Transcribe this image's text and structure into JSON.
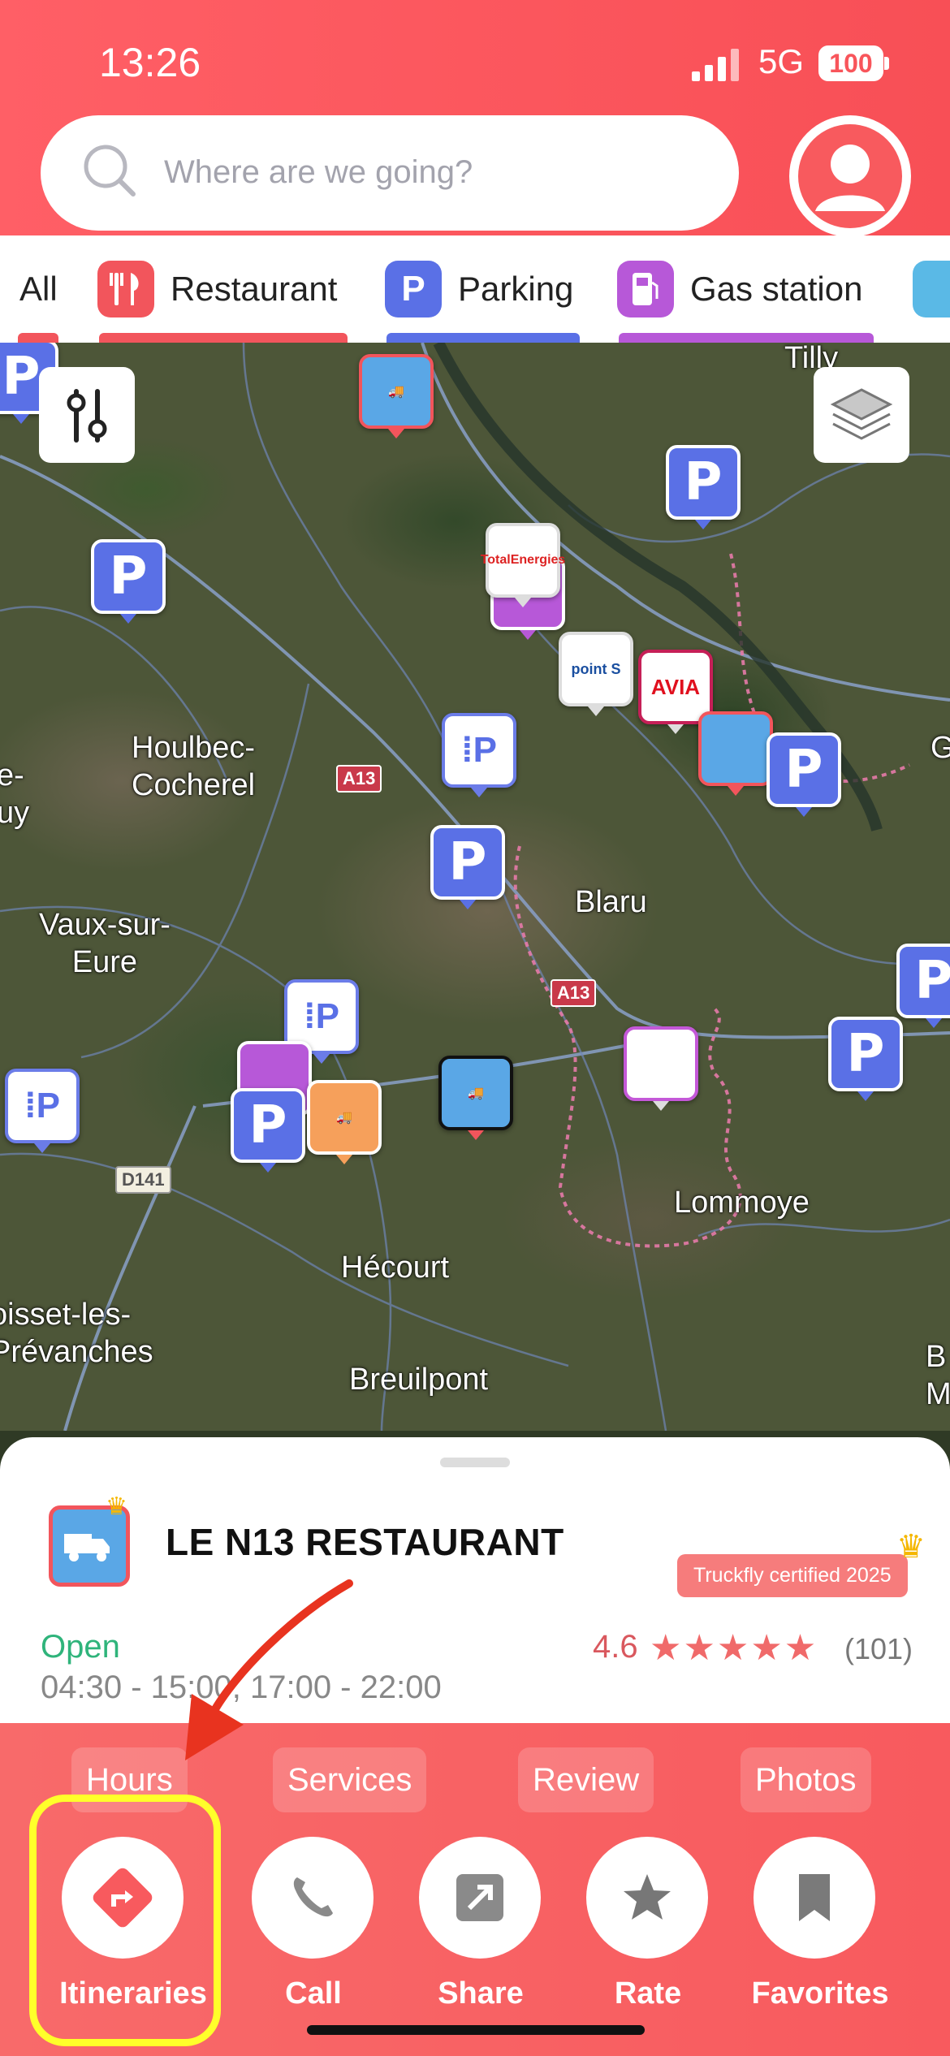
{
  "status": {
    "time": "13:26",
    "network": "5G",
    "battery": "100"
  },
  "search": {
    "placeholder": "Where are we going?"
  },
  "categories": [
    {
      "label": "All"
    },
    {
      "label": "Restaurant",
      "color": "#f2555c"
    },
    {
      "label": "Parking",
      "color": "#5a70e6"
    },
    {
      "label": "Gas station",
      "color": "#b758d8"
    }
  ],
  "map": {
    "towns": [
      "Tilly",
      "Houlbec-\nCocherel",
      "Vaux-sur-\nEure",
      "Blaru",
      "Lommoye",
      "Hécourt",
      "Breuilpont",
      "oisset-les-\nPrévanches",
      "e-\nuy",
      "G",
      "B\nMa"
    ],
    "roads": [
      "A13",
      "A13",
      "D141"
    ],
    "brand_pins": [
      "point S",
      "AVIA",
      "TotalEnergies"
    ]
  },
  "place": {
    "name": "LE N13 RESTAURANT",
    "badge": "Truckfly certified 2025",
    "status": "Open",
    "hours": "04:30 - 15:00, 17:00 - 22:00",
    "rating": "4.6",
    "stars": "★★★★★",
    "reviews": "(101)"
  },
  "tabs": [
    "Hours",
    "Services",
    "Review",
    "Photos"
  ],
  "actions": [
    {
      "label": "Itineraries",
      "icon": "directions-icon"
    },
    {
      "label": "Call",
      "icon": "phone-icon"
    },
    {
      "label": "Share",
      "icon": "share-icon"
    },
    {
      "label": "Rate",
      "icon": "star-icon"
    },
    {
      "label": "Favorites",
      "icon": "bookmark-icon"
    }
  ],
  "colors": {
    "brand": "#f85a5e",
    "highlight": "#ffff2a",
    "open": "#2fb47b",
    "annotation_arrow": "#e8331f"
  }
}
